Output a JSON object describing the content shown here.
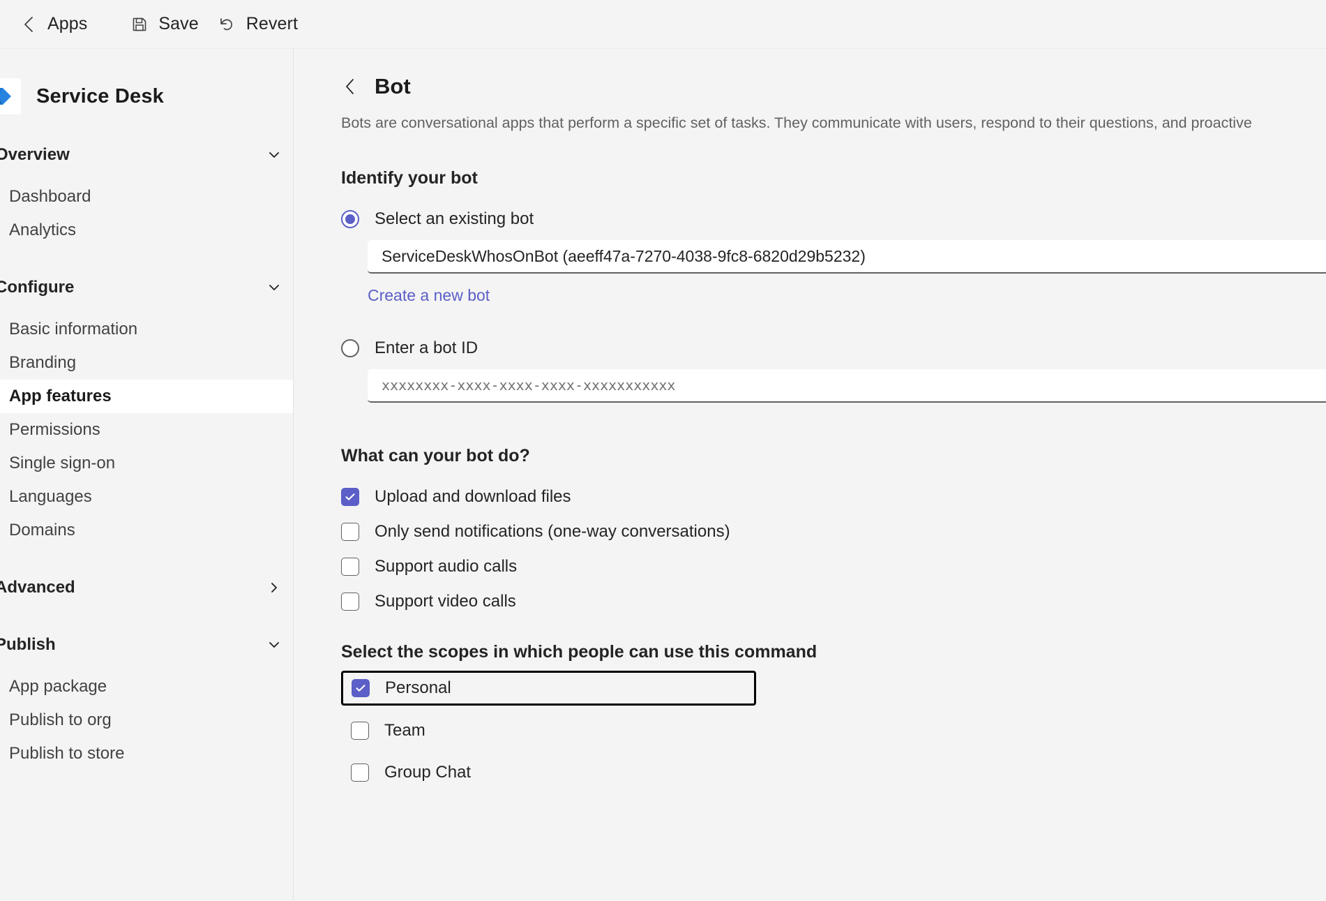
{
  "toolbar": {
    "back_label": "Apps",
    "back_icon": "chevron-left-icon",
    "save_label": "Save",
    "save_icon": "save-floppy-icon",
    "revert_label": "Revert",
    "revert_icon": "revert-undo-icon"
  },
  "sidebar": {
    "app_title": "Service Desk",
    "app_logo_icon": "service-desk-arrow-logo",
    "groups": [
      {
        "label": "Overview",
        "chevron": "chevron-down-icon",
        "expanded": true,
        "items": [
          {
            "label": "Dashboard",
            "active": false
          },
          {
            "label": "Analytics",
            "active": false
          }
        ]
      },
      {
        "label": "Configure",
        "chevron": "chevron-down-icon",
        "expanded": true,
        "items": [
          {
            "label": "Basic information",
            "active": false
          },
          {
            "label": "Branding",
            "active": false
          },
          {
            "label": "App features",
            "active": true
          },
          {
            "label": "Permissions",
            "active": false
          },
          {
            "label": "Single sign-on",
            "active": false
          },
          {
            "label": "Languages",
            "active": false
          },
          {
            "label": "Domains",
            "active": false
          }
        ]
      },
      {
        "label": "Advanced",
        "chevron": "chevron-right-icon",
        "expanded": false,
        "items": []
      },
      {
        "label": "Publish",
        "chevron": "chevron-down-icon",
        "expanded": true,
        "items": [
          {
            "label": "App package",
            "active": false
          },
          {
            "label": "Publish to org",
            "active": false
          },
          {
            "label": "Publish to store",
            "active": false
          }
        ]
      }
    ]
  },
  "main": {
    "back_icon": "chevron-left-icon",
    "title": "Bot",
    "description": "Bots are conversational apps that perform a specific set of tasks. They communicate with users, respond to their questions, and proactive",
    "identify_section_title": "Identify your bot",
    "radio_existing": {
      "label": "Select an existing bot",
      "checked": true
    },
    "bot_select_value": "ServiceDeskWhosOnBot (aeeff47a-7270-4038-9fc8-6820d29b5232)",
    "create_new_bot_link": "Create a new bot",
    "radio_bot_id": {
      "label": "Enter a bot ID",
      "checked": false
    },
    "bot_id_placeholder": "xxxxxxxx-xxxx-xxxx-xxxx-xxxxxxxxxxx",
    "capabilities_title": "What can your bot do?",
    "capabilities": [
      {
        "label": "Upload and download files",
        "checked": true
      },
      {
        "label": "Only send notifications (one-way conversations)",
        "checked": false
      },
      {
        "label": "Support audio calls",
        "checked": false
      },
      {
        "label": "Support video calls",
        "checked": false
      }
    ],
    "scopes_title": "Select the scopes in which people can use this command",
    "scopes": [
      {
        "label": "Personal",
        "checked": true,
        "focused": true
      },
      {
        "label": "Team",
        "checked": false,
        "focused": false
      },
      {
        "label": "Group Chat",
        "checked": false,
        "focused": false
      }
    ]
  },
  "colors": {
    "accent": "#5b5fc7",
    "link": "#5b5fc7",
    "page_bg": "#f4f4f4",
    "active_item_bg": "#ffffff",
    "focus_ring": "#000000"
  }
}
